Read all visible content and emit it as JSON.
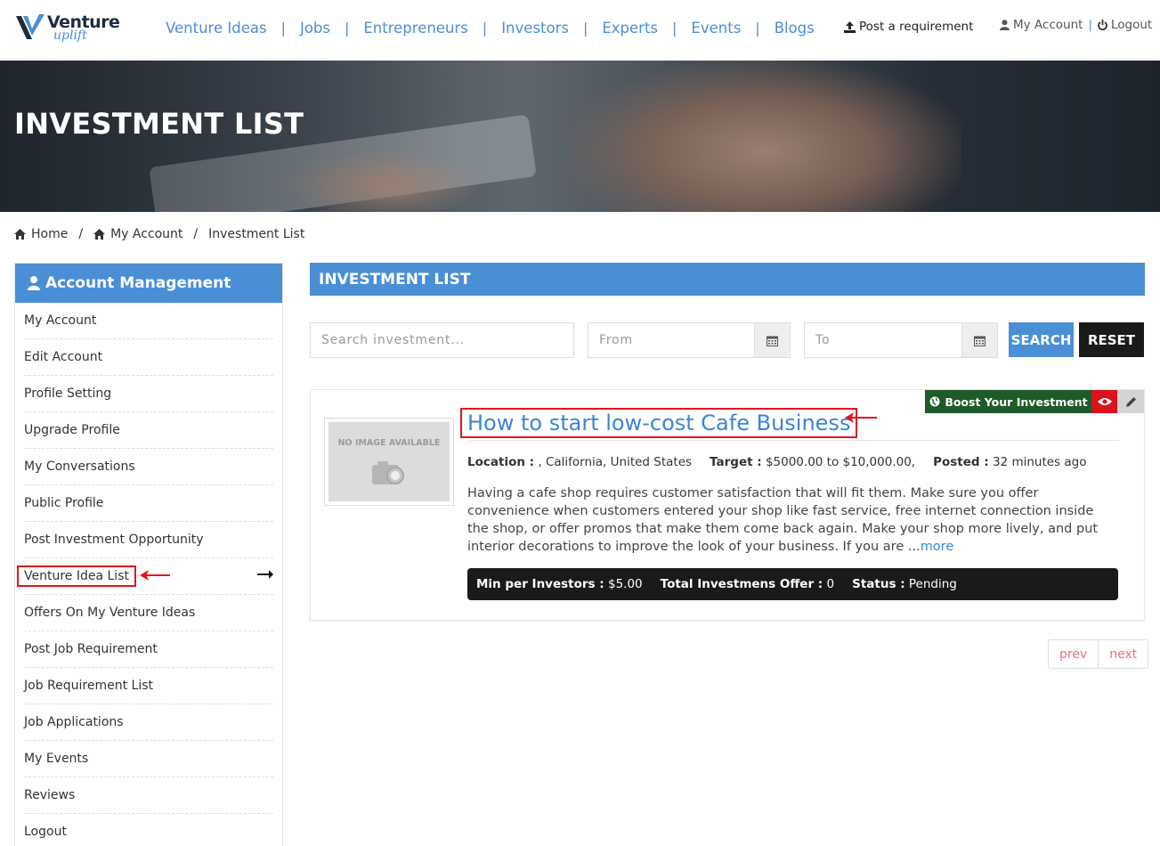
{
  "header": {
    "logo_text": "Venture",
    "logo_sub": "uplift",
    "nav": [
      "Venture Ideas",
      "Jobs",
      "Entrepreneurs",
      "Investors",
      "Experts",
      "Events",
      "Blogs"
    ],
    "post_requirement": "Post a requirement",
    "my_account": "My Account",
    "logout": "Logout",
    "accent_color": "#4a8fd6"
  },
  "hero": {
    "title": "INVESTMENT LIST"
  },
  "breadcrumb": {
    "home": "Home",
    "my_account": "My Account",
    "current": "Investment List"
  },
  "sidebar": {
    "title": "Account Management",
    "items": [
      "My Account",
      "Edit Account",
      "Profile Setting",
      "Upgrade Profile",
      "My Conversations",
      "Public Profile",
      "Post Investment Opportunity",
      "Venture Idea List",
      "Offers On My Venture Ideas",
      "Post Job Requirement",
      "Job Requirement List",
      "Job Applications",
      "My Events",
      "Reviews",
      "Logout"
    ],
    "highlighted_item": "Venture Idea List"
  },
  "main": {
    "title": "INVESTMENT LIST",
    "search_placeholder": "Search investment...",
    "from_placeholder": "From",
    "to_placeholder": "To",
    "search_label": "SEARCH",
    "reset_label": "RESET"
  },
  "listing": {
    "boost_label": "Boost Your Investment",
    "no_image_text": "NO IMAGE AVAILABLE",
    "title": "How to start low-cost Cafe Business",
    "location_label": "Location :",
    "location_value": ", California, United States",
    "target_label": "Target :",
    "target_value": "$5000.00 to $10,000.00,",
    "posted_label": "Posted :",
    "posted_value": "32 minutes ago",
    "description": "Having a cafe shop requires customer satisfaction that will fit them. Make sure you offer convenience when customers entered your shop like fast service, free internet connection inside the shop, or offer promos that make them come back again. Make your shop more lively, and put interior decorations to improve the look of your business. If you are ...",
    "more_label": "more",
    "min_label": "Min per Investors :",
    "min_value": "$5.00",
    "total_label": "Total Investmens Offer :",
    "total_value": "0",
    "status_label": "Status :",
    "status_value": "Pending"
  },
  "pagination": {
    "prev": "prev",
    "next": "next"
  }
}
